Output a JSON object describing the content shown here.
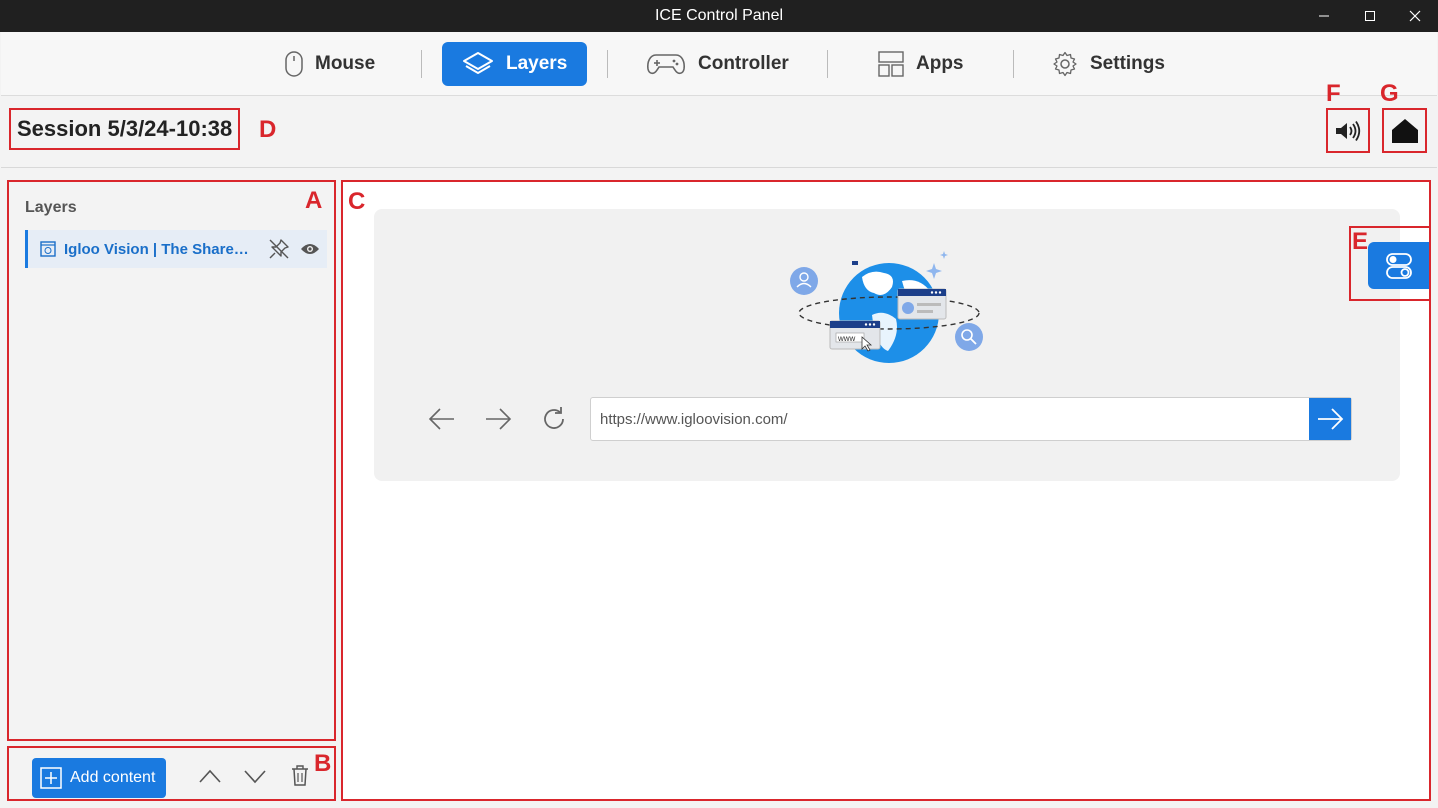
{
  "window": {
    "title": "ICE Control Panel"
  },
  "nav": {
    "mouse": "Mouse",
    "layers": "Layers",
    "controller": "Controller",
    "apps": "Apps",
    "settings": "Settings"
  },
  "header": {
    "session_title": "Session 5/3/24-10:38"
  },
  "layers_panel": {
    "title": "Layers",
    "items": [
      {
        "label": "Igloo Vision | The Shared Immersive Space"
      }
    ]
  },
  "toolbar": {
    "add_content": "Add content"
  },
  "browser": {
    "url": "https://www.igloovision.com/",
    "illustration_text": "www"
  },
  "markers": {
    "a": "A",
    "b": "B",
    "c": "C",
    "d": "D",
    "e": "E",
    "f": "F",
    "g": "G"
  },
  "colors": {
    "accent": "#1a7ae0",
    "annotation": "#d9262c",
    "titlebar": "#202020"
  }
}
